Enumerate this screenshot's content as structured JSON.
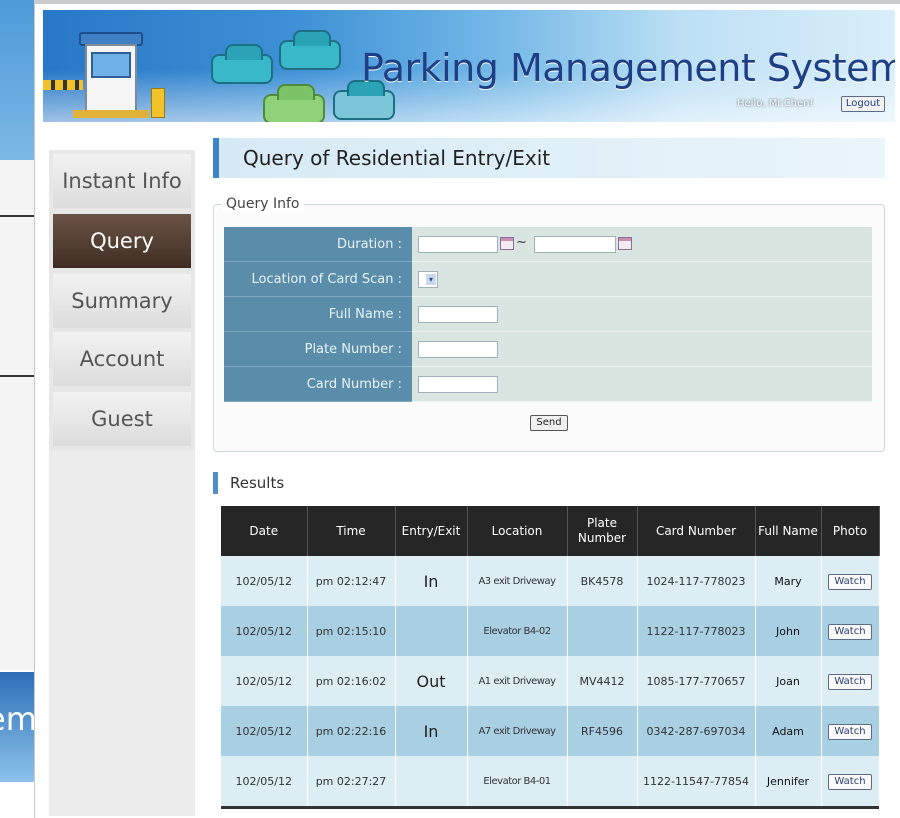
{
  "background": {
    "left_fragment_text": "em"
  },
  "header": {
    "app_title": "Parking Management System",
    "greeting": "Hello, Mr.Chen!",
    "logout_label": "Logout"
  },
  "sidebar": {
    "items": [
      {
        "label": "Instant Info",
        "active": false
      },
      {
        "label": "Query",
        "active": true
      },
      {
        "label": "Summary",
        "active": false
      },
      {
        "label": "Account",
        "active": false
      },
      {
        "label": "Guest",
        "active": false
      }
    ]
  },
  "page": {
    "title": "Query of Residential Entry/Exit"
  },
  "query_form": {
    "legend": "Query Info",
    "fields": {
      "duration_label": "Duration :",
      "duration_separator": "~",
      "location_label": "Location of Card Scan :",
      "full_name_label": "Full Name :",
      "plate_number_label": "Plate Number :",
      "card_number_label": "Card Number :"
    },
    "values": {
      "duration_from": "",
      "duration_to": "",
      "location": "",
      "full_name": "",
      "plate_number": "",
      "card_number": ""
    },
    "send_label": "Send"
  },
  "results": {
    "title": "Results",
    "columns": [
      "Date",
      "Time",
      "Entry/Exit",
      "Location",
      "Plate Number",
      "Card Number",
      "Full Name",
      "Photo"
    ],
    "watch_label": "Watch",
    "rows": [
      {
        "date": "102/05/12",
        "time": "pm 02:12:47",
        "entry_exit": "In",
        "location": "A3 exit Driveway",
        "plate": "BK4578",
        "card": "1024-117-778023",
        "name": "Mary"
      },
      {
        "date": "102/05/12",
        "time": "pm 02:15:10",
        "entry_exit": "",
        "location": "Elevator B4-02",
        "plate": "",
        "card": "1122-117-778023",
        "name": "John"
      },
      {
        "date": "102/05/12",
        "time": "pm 02:16:02",
        "entry_exit": "Out",
        "location": "A1 exit Driveway",
        "plate": "MV4412",
        "card": "1085-177-770657",
        "name": "Joan"
      },
      {
        "date": "102/05/12",
        "time": "pm 02:22:16",
        "entry_exit": "In",
        "location": "A7 exit Driveway",
        "plate": "RF4596",
        "card": "0342-287-697034",
        "name": "Adam"
      },
      {
        "date": "102/05/12",
        "time": "pm 02:27:27",
        "entry_exit": "",
        "location": "Elevator B4-01",
        "plate": "",
        "card": "1122-11547-77854",
        "name": "Jennifer"
      }
    ]
  },
  "colors": {
    "nav_active": "#4a3628",
    "form_label_bg": "#5a8daa",
    "table_header_bg": "#262626",
    "row_light": "#dcedf4",
    "row_dark": "#a9cfe3"
  }
}
